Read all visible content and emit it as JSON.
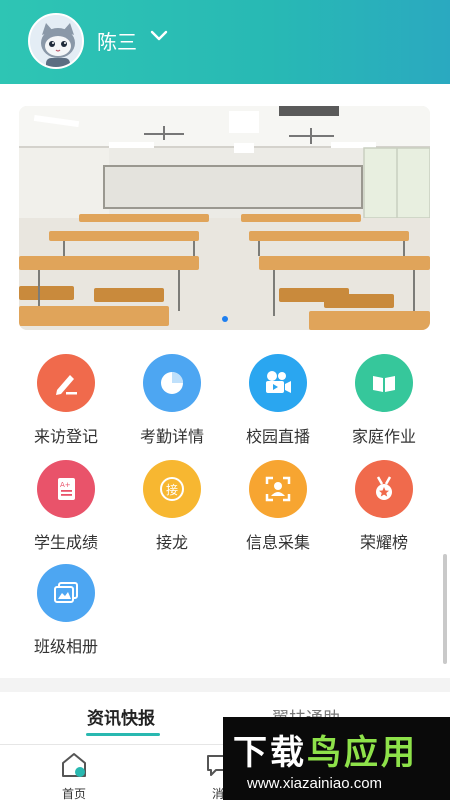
{
  "header": {
    "user_name": "陈三",
    "avatar_icon": "cat-avatar-icon",
    "dropdown_icon": "chevron-down-icon",
    "colors": {
      "gradient_start": "#2ec5b4",
      "gradient_end": "#2aa9c0"
    }
  },
  "banner": {
    "image_subject": "classroom-photo",
    "slides_count": 1,
    "active_slide": 1
  },
  "menu": {
    "items": [
      {
        "label": "来访登记",
        "icon": "pen-icon",
        "color": "#f06a4c"
      },
      {
        "label": "考勤详情",
        "icon": "pie-chart-icon",
        "color": "#4da6f2"
      },
      {
        "label": "校园直播",
        "icon": "video-camera-icon",
        "color": "#2aa6f0"
      },
      {
        "label": "家庭作业",
        "icon": "book-icon",
        "color": "#36c79b"
      },
      {
        "label": "学生成绩",
        "icon": "grade-sheet-icon",
        "color": "#e9536a"
      },
      {
        "label": "接龙",
        "icon": "relay-icon",
        "color": "#f7b731",
        "icon_text": "接"
      },
      {
        "label": "信息采集",
        "icon": "id-scan-icon",
        "color": "#f7a531"
      },
      {
        "label": "荣耀榜",
        "icon": "medal-icon",
        "color": "#f06a4c"
      },
      {
        "label": "班级相册",
        "icon": "photo-album-icon",
        "color": "#4da6f2"
      }
    ]
  },
  "news_tabs": {
    "tabs": [
      {
        "label": "资讯快报",
        "active": true
      },
      {
        "label": "翼扶通助",
        "active": false
      }
    ],
    "accent_color": "#29b8b0"
  },
  "bottom_nav": {
    "items": [
      {
        "label": "首页",
        "icon": "home-icon"
      },
      {
        "label": "消",
        "icon": "message-icon"
      }
    ]
  },
  "watermark": {
    "title_prefix": "下载",
    "title_suffix": "鸟应用",
    "url": "www.xiazainiao.com"
  }
}
